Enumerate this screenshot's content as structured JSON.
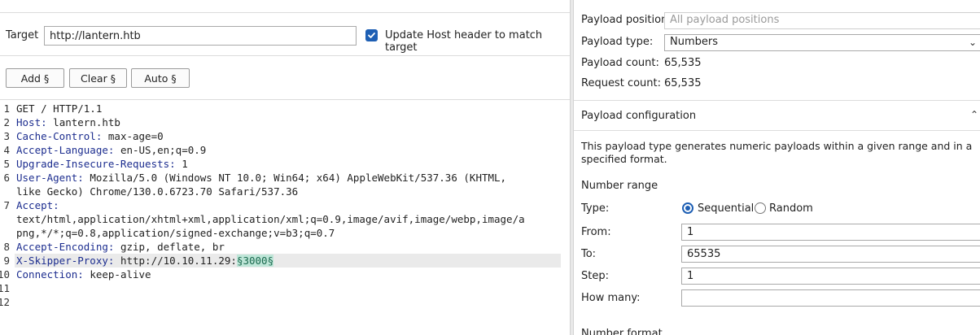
{
  "left": {
    "target_label": "Target",
    "target_value": "http://lantern.htb",
    "update_host_label": "Update Host header to match target",
    "buttons": {
      "add": "Add §",
      "clear": "Clear §",
      "auto": "Auto §"
    },
    "request_lines": [
      {
        "num": "1",
        "text": "GET / HTTP/1.1"
      },
      {
        "num": "2",
        "name": "Host",
        "value": " lantern.htb"
      },
      {
        "num": "3",
        "name": "Cache-Control",
        "value": " max-age=0"
      },
      {
        "num": "4",
        "name": "Accept-Language",
        "value": " en-US,en;q=0.9"
      },
      {
        "num": "5",
        "name": "Upgrade-Insecure-Requests",
        "value": " 1"
      },
      {
        "num": "6",
        "name": "User-Agent",
        "value": " Mozilla/5.0 (Windows NT 10.0; Win64; x64) AppleWebKit/537.36 (KHTML,",
        "wrap": "like Gecko) Chrome/130.0.6723.70 Safari/537.36"
      },
      {
        "num": "7",
        "name": "Accept",
        "value": "",
        "wrap": "text/html,application/xhtml+xml,application/xml;q=0.9,image/avif,image/webp,image/a",
        "wrap2": "png,*/*;q=0.8,application/signed-exchange;v=b3;q=0.7"
      },
      {
        "num": "8",
        "name": "Accept-Encoding",
        "value": " gzip, deflate, br"
      },
      {
        "num": "9",
        "name": "X-Skipper-Proxy",
        "value": " http://10.10.11.29:",
        "payload": "§3000§"
      },
      {
        "num": "10",
        "name": "Connection",
        "value": " keep-alive"
      },
      {
        "num": "11",
        "text": ""
      },
      {
        "num": "12",
        "text": ""
      }
    ]
  },
  "right": {
    "payload_position_label": "Payload position:",
    "payload_position_value": "All payload positions",
    "payload_type_label": "Payload type:",
    "payload_type_value": "Numbers",
    "payload_count_label": "Payload count:",
    "payload_count_value": "65,535",
    "request_count_label": "Request count:",
    "request_count_value": "65,535",
    "config_title": "Payload configuration",
    "config_desc": "This payload type generates numeric payloads within a given range and in a specified format.",
    "number_range_label": "Number range",
    "type_label": "Type:",
    "sequential_label": "Sequential",
    "random_label": "Random",
    "from_label": "From:",
    "from_value": "1",
    "to_label": "To:",
    "to_value": "65535",
    "step_label": "Step:",
    "step_value": "1",
    "how_many_label": "How many:",
    "how_many_value": "",
    "number_format_label": "Number format"
  },
  "icons": {
    "checkbox": "check-icon",
    "select_arrow": "chevron-down-icon",
    "section_toggle": "chevron-up-icon"
  },
  "colors": {
    "accent": "#1e5fb4",
    "header_name": "#1c2d8f",
    "payload_bg": "#bfe6d8",
    "payload_fg": "#1b6a4f",
    "top_button": "#ff6633"
  }
}
